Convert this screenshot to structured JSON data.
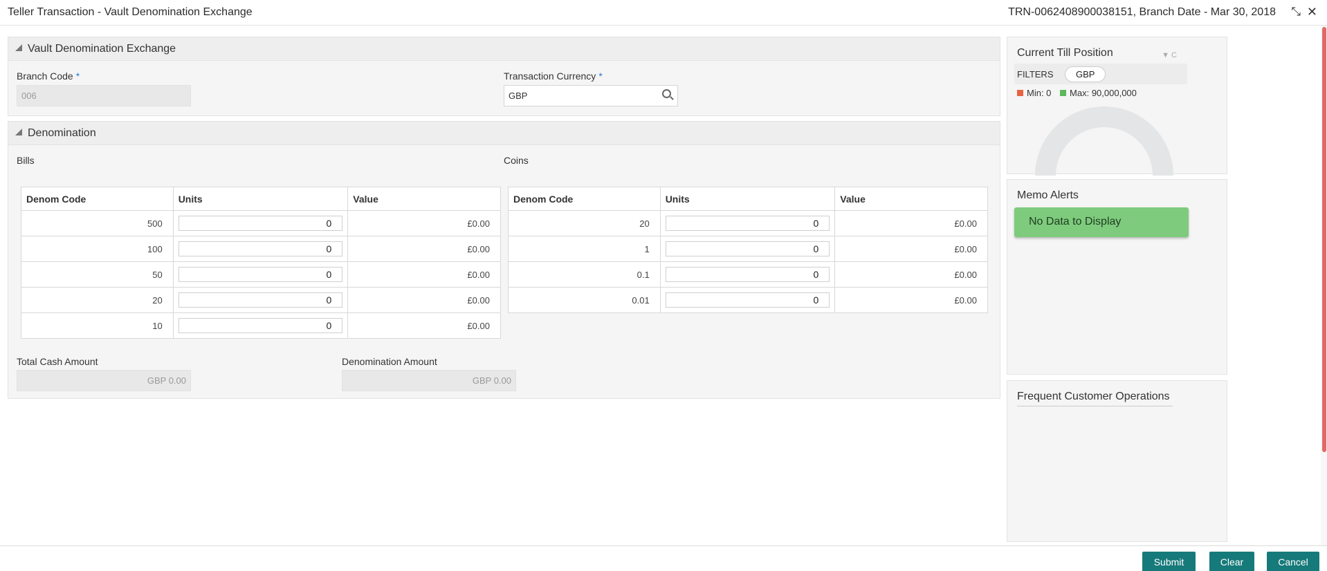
{
  "header": {
    "title": "Teller Transaction - Vault Denomination Exchange",
    "reference": "TRN-0062408900038151, Branch Date - Mar 30, 2018",
    "minimize_icon": "minimize-icon",
    "close_icon": "close-icon"
  },
  "vault_section": {
    "title": "Vault Denomination Exchange",
    "branch_code_label": "Branch Code",
    "branch_code_value": "006",
    "currency_label": "Transaction Currency",
    "currency_value": "GBP",
    "required_mark": "*"
  },
  "denomination_section": {
    "title": "Denomination",
    "bills_label": "Bills",
    "coins_label": "Coins",
    "columns": [
      "Denom Code",
      "Units",
      "Value"
    ],
    "bills": [
      {
        "code": "500",
        "units": "0",
        "value": "£0.00"
      },
      {
        "code": "100",
        "units": "0",
        "value": "£0.00"
      },
      {
        "code": "50",
        "units": "0",
        "value": "£0.00"
      },
      {
        "code": "20",
        "units": "0",
        "value": "£0.00"
      },
      {
        "code": "10",
        "units": "0",
        "value": "£0.00"
      }
    ],
    "coins": [
      {
        "code": "20",
        "units": "0",
        "value": "£0.00"
      },
      {
        "code": "1",
        "units": "0",
        "value": "£0.00"
      },
      {
        "code": "0.1",
        "units": "0",
        "value": "£0.00"
      },
      {
        "code": "0.01",
        "units": "0",
        "value": "£0.00"
      }
    ],
    "total_cash_label": "Total Cash Amount",
    "total_cash_value": "GBP 0.00",
    "denomination_amount_label": "Denomination Amount",
    "denomination_amount_value": "GBP 0.00"
  },
  "till_position": {
    "title": "Current Till Position",
    "filters_label": "FILTERS",
    "filter_chip": "GBP",
    "min_label": "Min: 0",
    "max_label": "Max: 90,000,000",
    "min_color": "#e8623f",
    "max_color": "#5cb85c"
  },
  "memo_alerts": {
    "title": "Memo Alerts",
    "empty_message": "No Data to Display"
  },
  "frequent_ops": {
    "title": "Frequent Customer Operations"
  },
  "footer": {
    "submit": "Submit",
    "clear": "Clear",
    "cancel": "Cancel"
  }
}
